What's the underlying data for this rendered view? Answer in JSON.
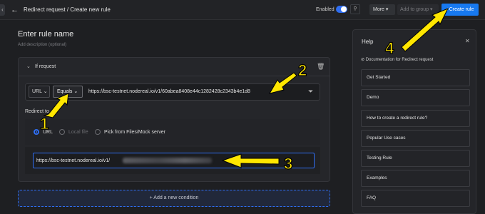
{
  "topbar": {
    "breadcrumb": "Redirect request / Create new rule",
    "enabled_label": "Enabled",
    "more_label": "More",
    "add_to_group_label": "Add to group",
    "create_rule_label": "+Create rule",
    "accent": "#1779f0"
  },
  "rule": {
    "name_placeholder": "Enter rule name",
    "description_placeholder": "Add description (optional)"
  },
  "condition": {
    "header": "If request",
    "source_type": "URL",
    "operator": "Equals",
    "url_value": "https://bsc-testnet.nodereal.io/v1/60abea8408e44c1282428c2343b4e1d8",
    "redirect_to_label": "Redirect to",
    "options": [
      "URL",
      "Local file",
      "Pick from Files/Mock server"
    ],
    "selected_option": "URL",
    "destination_value": "https://bsc-testnet.nodereal.io/v1/"
  },
  "add_condition_label": "+ Add a new condition",
  "help": {
    "title": "Help",
    "doc_link": "Documentation for Redirect request",
    "items": [
      "Get Started",
      "Demo",
      "How to create a redirect rule?",
      "Popular Use cases",
      "Testing Rule",
      "Examples",
      "FAQ"
    ]
  },
  "annotations": {
    "numbers": [
      "1",
      "2",
      "3",
      "4"
    ],
    "arrow_color": "#ffe600"
  }
}
